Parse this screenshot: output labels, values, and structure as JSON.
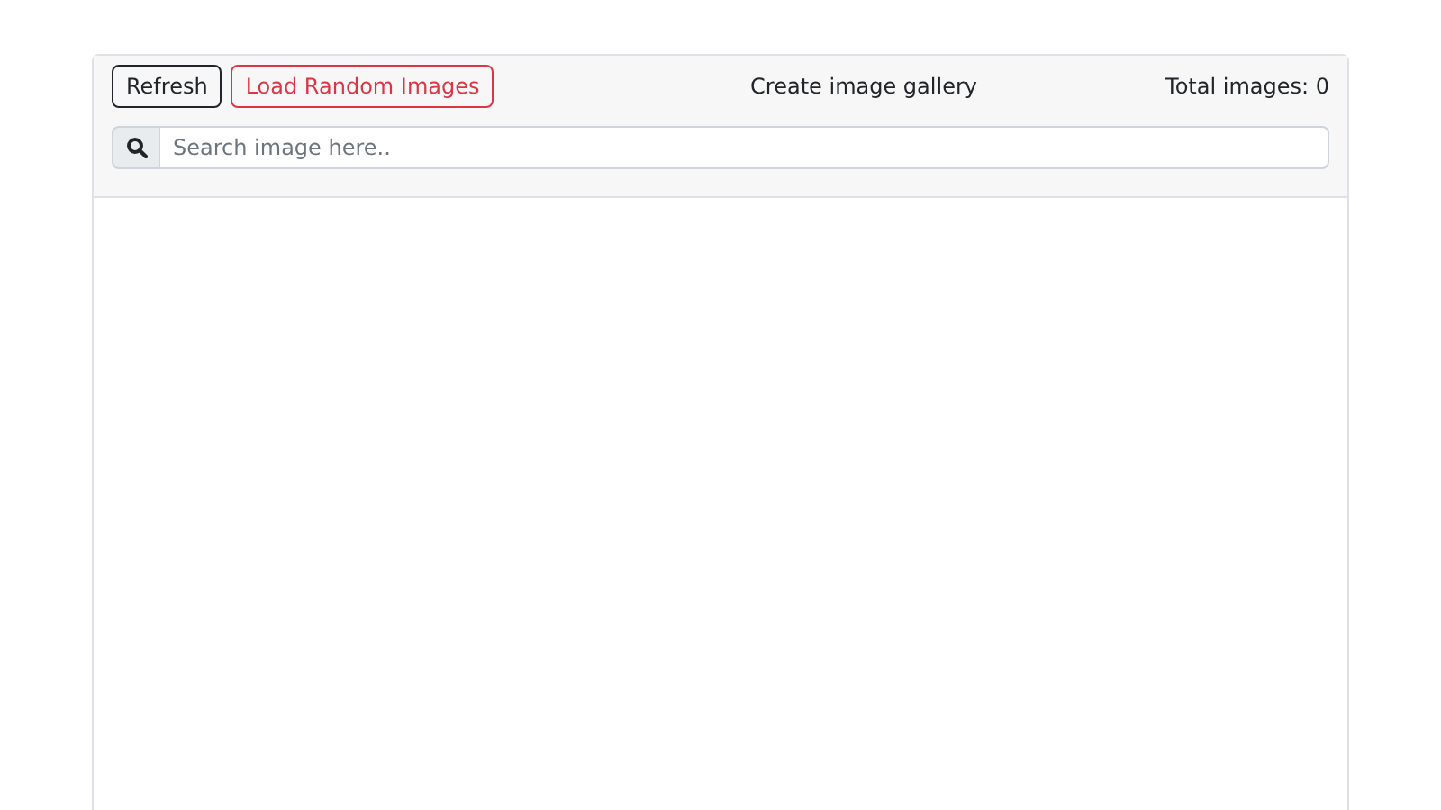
{
  "toolbar": {
    "buttons": [
      {
        "label": "Refresh",
        "kind": "dark"
      },
      {
        "label": "Load Random Images",
        "kind": "danger"
      }
    ],
    "title": "Create image gallery",
    "total": "Total images: 0"
  },
  "search": {
    "placeholder": "Search image here.."
  }
}
